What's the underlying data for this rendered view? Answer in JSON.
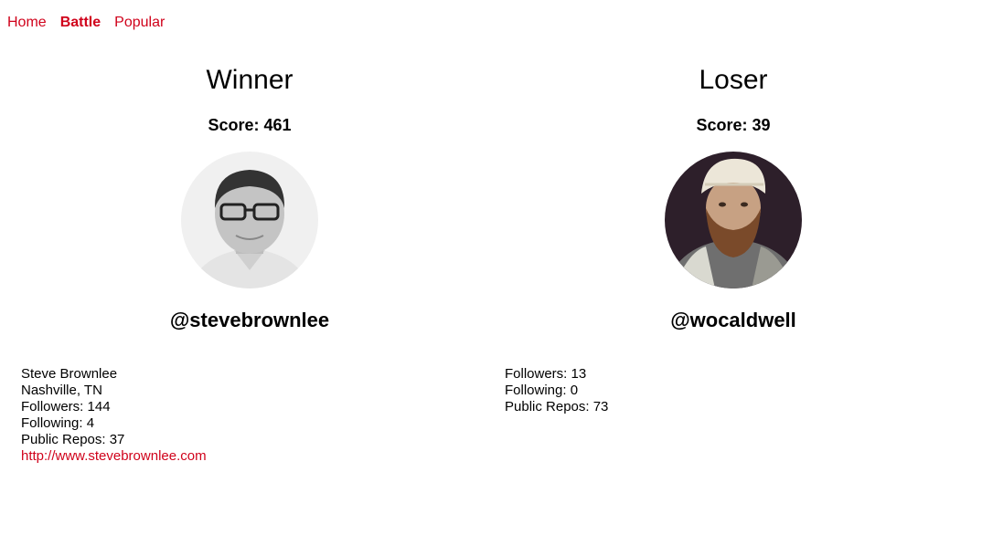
{
  "nav": {
    "items": [
      {
        "label": "Home",
        "active": false
      },
      {
        "label": "Battle",
        "active": true
      },
      {
        "label": "Popular",
        "active": false
      }
    ]
  },
  "winner": {
    "header": "Winner",
    "score": "Score: 461",
    "username": "@stevebrownlee",
    "name": "Steve Brownlee",
    "location": "Nashville, TN",
    "followers": "Followers: 144",
    "following": "Following: 4",
    "public_repos": "Public Repos: 37",
    "blog": "http://www.stevebrownlee.com"
  },
  "loser": {
    "header": "Loser",
    "score": "Score: 39",
    "username": "@wocaldwell",
    "followers": "Followers: 13",
    "following": "Following: 0",
    "public_repos": "Public Repos: 73"
  },
  "colors": {
    "accent": "#d0021b",
    "text": "#000000",
    "background": "#ffffff"
  }
}
